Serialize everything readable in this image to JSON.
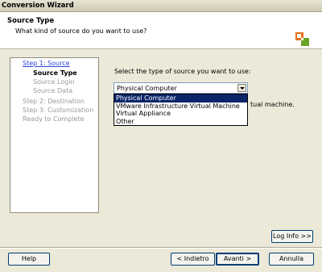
{
  "window": {
    "title": "Conversion Wizard"
  },
  "header": {
    "title": "Source Type",
    "subtitle": "What kind of source do you want to use?"
  },
  "nav": {
    "items": [
      {
        "label": "Step 1: Source",
        "state": "link"
      },
      {
        "label": "Source Type",
        "state": "current"
      },
      {
        "label": "Source Login",
        "state": "disabled"
      },
      {
        "label": "Source Data",
        "state": "disabled"
      },
      {
        "label": "Step 2: Destination",
        "state": "disabled"
      },
      {
        "label": "Step 3: Customization",
        "state": "disabled"
      },
      {
        "label": "Ready to Complete",
        "state": "disabled"
      }
    ]
  },
  "main": {
    "prompt": "Select the type of source you want to use:",
    "select": {
      "value": "Physical Computer",
      "options": [
        "Physical Computer",
        "VMware Infrastructure Virtual Machine",
        "Virtual Appliance",
        "Other"
      ]
    },
    "obscured_text": "tual machine."
  },
  "buttons": {
    "log_info": "Log Info >>",
    "help": "Help",
    "back": "< Indietro",
    "next": "Avanti >",
    "cancel": "Annulla"
  },
  "colors": {
    "logo_orange": "#e8731c",
    "logo_green": "#6aa329",
    "selection": "#0a246a",
    "link": "#2c46d6"
  }
}
